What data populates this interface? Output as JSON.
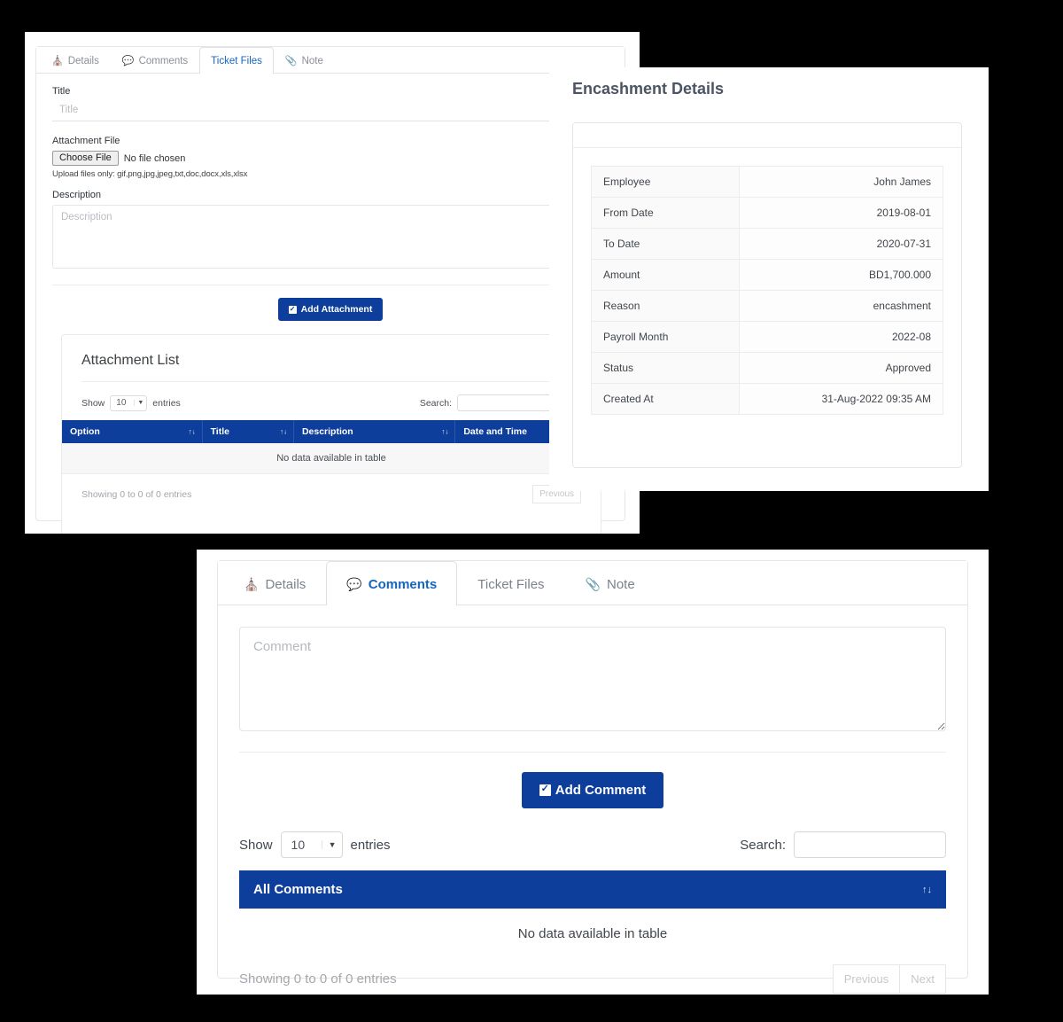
{
  "ticket_files_panel": {
    "tabs": [
      {
        "label": "Details",
        "icon": "home-icon",
        "glyph": "⌂",
        "active": false
      },
      {
        "label": "Comments",
        "icon": "comment-icon",
        "glyph": "💬",
        "active": false
      },
      {
        "label": "Ticket Files",
        "icon": "",
        "glyph": "",
        "active": true
      },
      {
        "label": "Note",
        "icon": "paperclip-icon",
        "glyph": "📎",
        "active": false
      }
    ],
    "title_label": "Title",
    "title_placeholder": "Title",
    "attachment_label": "Attachment File",
    "choose_file_label": "Choose File",
    "file_status": "No file chosen",
    "upload_hint": "Upload files only: gif,png,jpg,jpeg,txt,doc,docx,xls,xlsx",
    "description_label": "Description",
    "description_placeholder": "Description",
    "add_attachment_label": "Add Attachment",
    "attachment_list": {
      "heading": "Attachment List",
      "show_label": "Show",
      "entries_label": "entries",
      "page_size": "10",
      "search_label": "Search:",
      "search_value": "",
      "columns": [
        "Option",
        "Title",
        "Description",
        "Date and Time"
      ],
      "empty_text": "No data available in table",
      "showing_text": "Showing 0 to 0 of 0 entries",
      "previous_label": "Previous",
      "sort_glyph": "↑↓"
    }
  },
  "encashment_panel": {
    "title": "Encashment Details",
    "rows": [
      {
        "key": "Employee",
        "value": "John James"
      },
      {
        "key": "From Date",
        "value": "2019-08-01"
      },
      {
        "key": "To Date",
        "value": "2020-07-31"
      },
      {
        "key": "Amount",
        "value": "BD1,700.000"
      },
      {
        "key": "Reason",
        "value": "encashment"
      },
      {
        "key": "Payroll Month",
        "value": "2022-08"
      },
      {
        "key": "Status",
        "value": "Approved"
      },
      {
        "key": "Created At",
        "value": "31-Aug-2022 09:35 AM"
      }
    ]
  },
  "comments_panel": {
    "tabs": [
      {
        "label": "Details",
        "icon": "home-icon",
        "glyph": "⌂",
        "active": false
      },
      {
        "label": "Comments",
        "icon": "comment-icon",
        "glyph": "💬",
        "active": true
      },
      {
        "label": "Ticket Files",
        "icon": "",
        "glyph": "",
        "active": false
      },
      {
        "label": "Note",
        "icon": "paperclip-icon",
        "glyph": "📎",
        "active": false
      }
    ],
    "comment_placeholder": "Comment",
    "comment_value": "",
    "add_comment_label": "Add Comment",
    "show_label": "Show",
    "entries_label": "entries",
    "page_size": "10",
    "search_label": "Search:",
    "search_value": "",
    "table_header": "All Comments",
    "sort_glyph": "↑↓",
    "empty_text": "No data available in table",
    "showing_text": "Showing 0 to 0 of 0 entries",
    "previous_label": "Previous",
    "next_label": "Next"
  },
  "colors": {
    "primary_blue": "#0e3e9c",
    "link_blue": "#1566c0",
    "muted_text": "#8a8f96",
    "page_background": "#000000"
  }
}
